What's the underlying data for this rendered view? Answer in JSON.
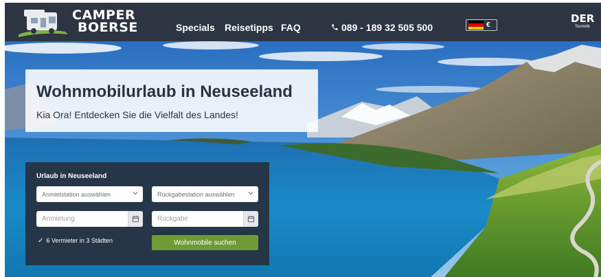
{
  "brand": {
    "logo_line1": "CAMPER",
    "logo_line2": "BOERSE",
    "partner_logo_main": "DER",
    "partner_logo_sub": "Touristik"
  },
  "nav": {
    "items": [
      "Specials",
      "Reisetipps",
      "FAQ"
    ],
    "phone_icon": "phone-icon",
    "phone": "089 - 189 32 505 500",
    "currency": "€"
  },
  "hero": {
    "title": "Wohnmobilurlaub in Neuseeland",
    "subtitle": "Kia Ora! Entdecken Sie die Vielfalt des Landes!"
  },
  "search": {
    "heading": "Urlaub in Neuseeland",
    "pickup_station": "Anmietstation auswählen",
    "return_station": "Rückgabestation auswählen",
    "pickup_date_placeholder": "Anmietung",
    "return_date_placeholder": "Rückgabe",
    "info": "6 Vermieter in 3 Städten",
    "submit": "Wohnmobile suchen"
  },
  "colors": {
    "header_bg": "#2d3442",
    "panel_bg": "#26303e",
    "button_green": "#6e9b35"
  }
}
